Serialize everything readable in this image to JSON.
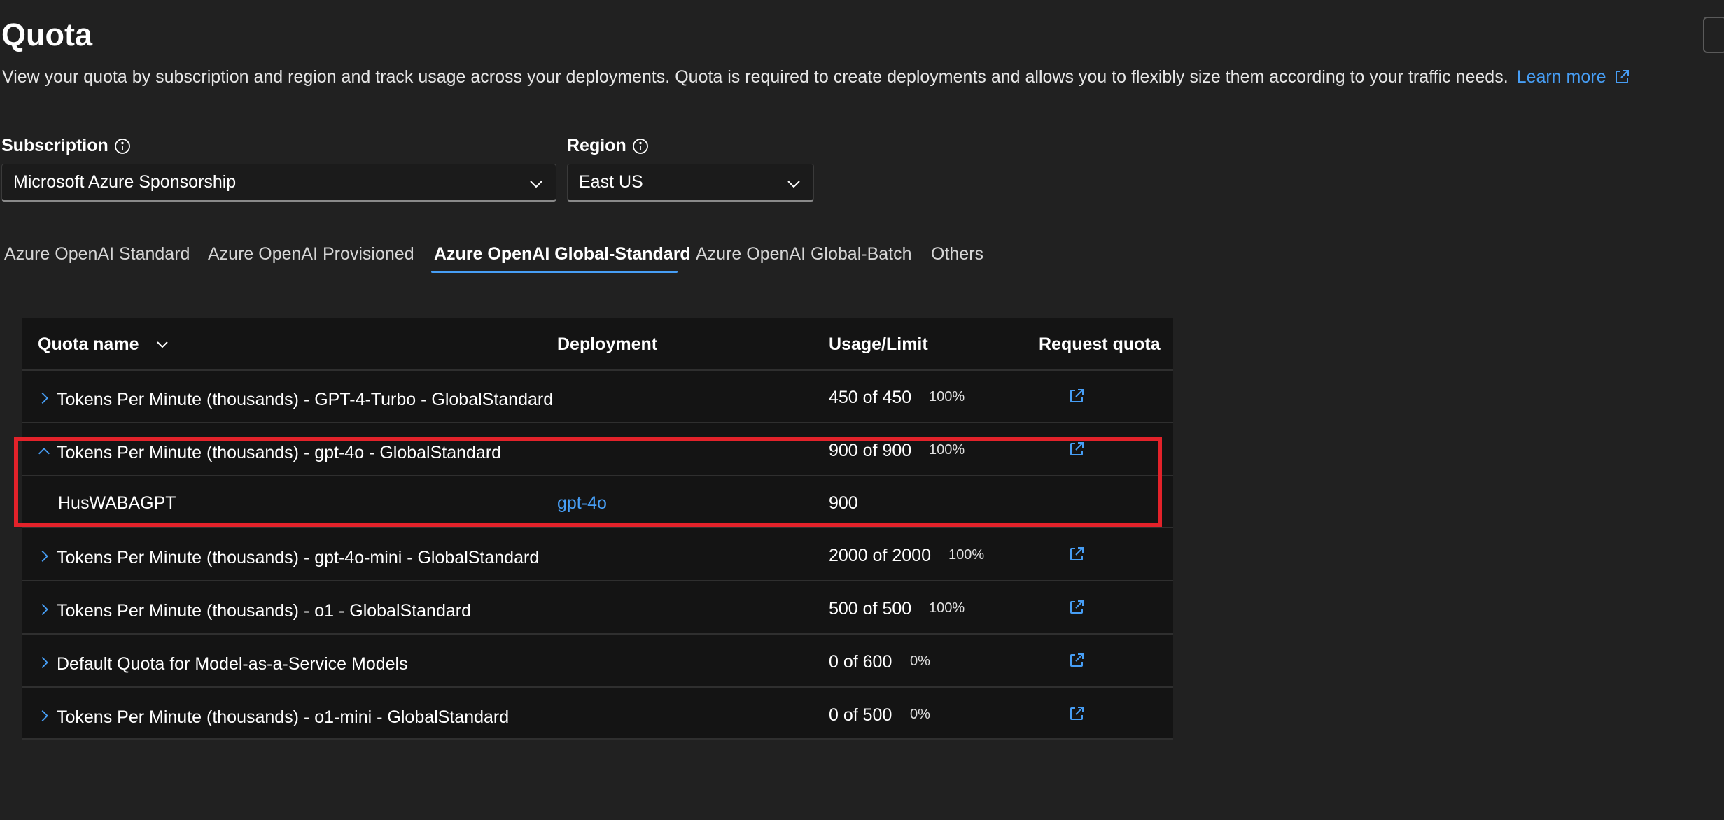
{
  "page": {
    "title": "Quota",
    "description": "View your quota by subscription and region and track usage across your deployments. Quota is required to create deployments and allows you to flexibly size them according to your traffic needs.",
    "learn_more": "Learn more"
  },
  "filters": {
    "subscription_label": "Subscription",
    "subscription_value": "Microsoft Azure Sponsorship",
    "region_label": "Region",
    "region_value": "East US"
  },
  "tabs": [
    {
      "label": "Azure OpenAI Standard",
      "active": false
    },
    {
      "label": "Azure OpenAI Provisioned",
      "active": false
    },
    {
      "label": "Azure OpenAI Global-Standard",
      "active": true
    },
    {
      "label": "Azure OpenAI Global-Batch",
      "active": false
    },
    {
      "label": "Others",
      "active": false
    }
  ],
  "table": {
    "columns": [
      "Quota name",
      "Deployment",
      "Usage/Limit",
      "Request quota"
    ],
    "rows": [
      {
        "name": "Tokens Per Minute (thousands) - GPT-4-Turbo - GlobalStandard",
        "usage": "450 of 450",
        "pct": "100%",
        "expanded": false
      },
      {
        "name": "Tokens Per Minute (thousands) - gpt-4o - GlobalStandard",
        "usage": "900 of 900",
        "pct": "100%",
        "expanded": true,
        "child": {
          "name": "HusWABAGPT",
          "deployment": "gpt-4o",
          "usage": "900"
        }
      },
      {
        "name": "Tokens Per Minute (thousands) - gpt-4o-mini - GlobalStandard",
        "usage": "2000 of 2000",
        "pct": "100%",
        "expanded": false
      },
      {
        "name": "Tokens Per Minute (thousands) - o1 - GlobalStandard",
        "usage": "500 of 500",
        "pct": "100%",
        "expanded": false
      },
      {
        "name": "Default Quota for Model-as-a-Service Models",
        "usage": "0 of 600",
        "pct": "0%",
        "expanded": false
      },
      {
        "name": "Tokens Per Minute (thousands) - o1-mini - GlobalStandard",
        "usage": "0 of 500",
        "pct": "0%",
        "expanded": false
      }
    ]
  },
  "colors": {
    "accent": "#479ef5",
    "highlight": "#e3222a",
    "background": "#212121"
  },
  "icons": [
    "info-icon",
    "chevron-down-icon",
    "chevron-right-icon",
    "chevron-up-icon",
    "external-link-icon"
  ]
}
